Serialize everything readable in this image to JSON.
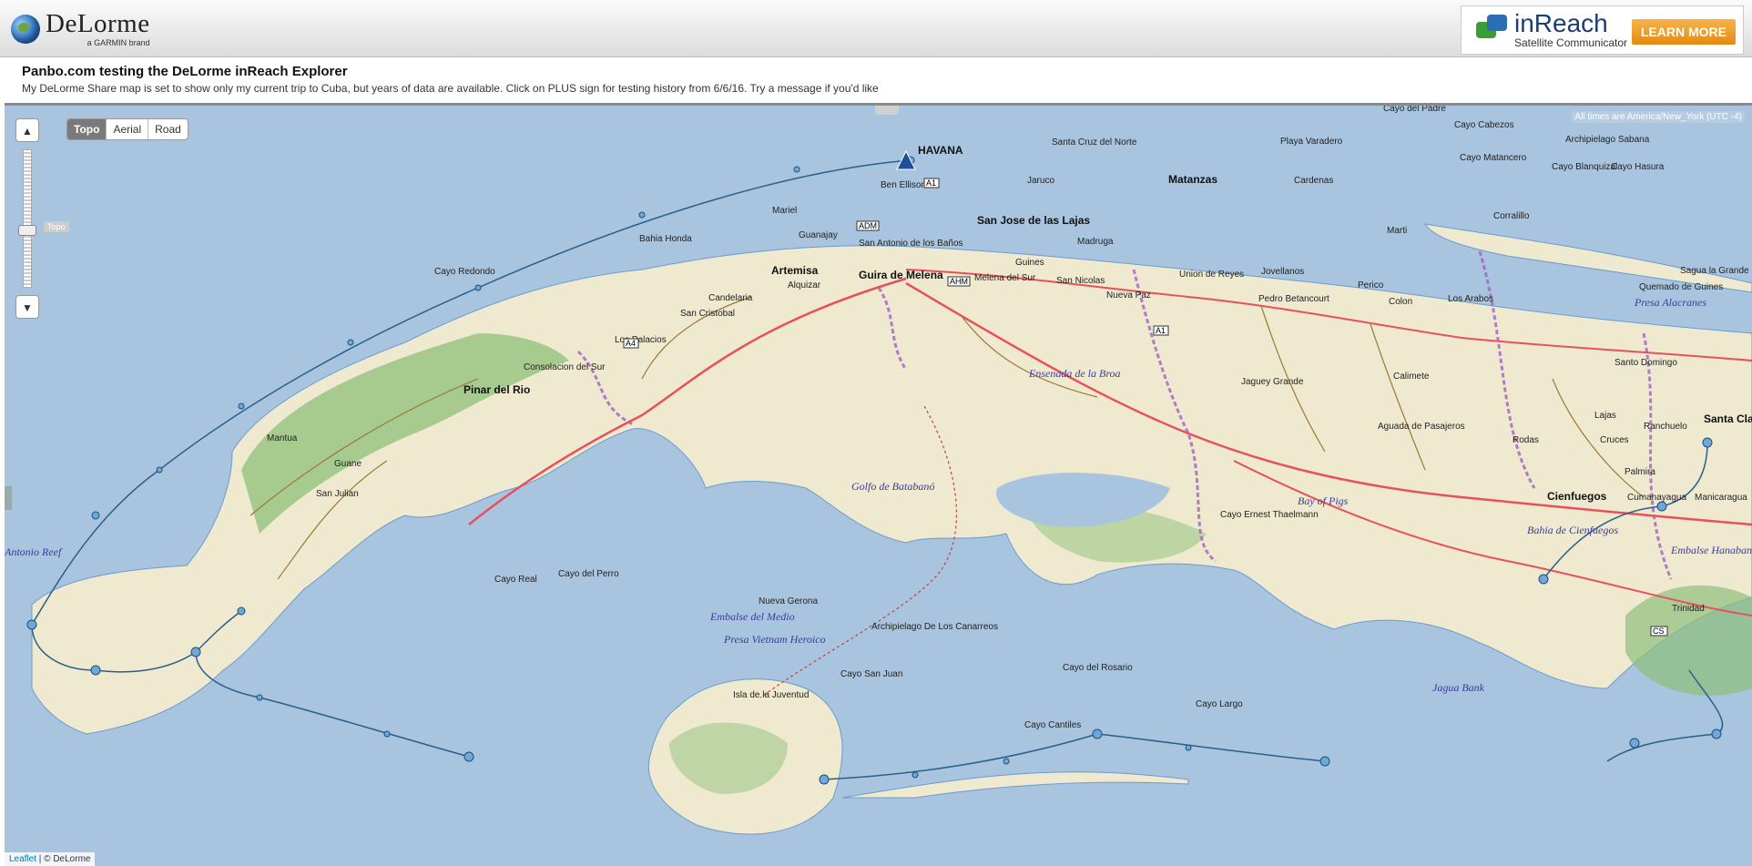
{
  "brand": {
    "name": "DeLorme",
    "sub": "a GARMIN brand"
  },
  "ad": {
    "title": "inReach",
    "subtitle": "Satellite Communicator",
    "button": "LEARN MORE"
  },
  "header": {
    "title": "Panbo.com testing the DeLorme inReach Explorer",
    "description": "My DeLorme Share map is set to show only my current trip to Cuba, but years of data are available. Click on PLUS sign for testing history from 6/6/16. Try a message if you'd like"
  },
  "map": {
    "layers": [
      "Topo",
      "Aerial",
      "Road"
    ],
    "selected_layer": "Topo",
    "zoom_tag": "Topo",
    "timezone": "All times are America/New_York (UTC -4)",
    "credit": {
      "leaflet": "Leaflet",
      "rest": " | © DeLorme"
    },
    "icons": [
      "zoom-in-icon",
      "zoom-out-icon",
      "collapse-icon",
      "expand-icon"
    ]
  },
  "places": {
    "havana": "HAVANA",
    "ben_ellison": "Ben Ellison",
    "mariel": "Mariel",
    "bahia_honda": "Bahia Honda",
    "guanajay": "Guanajay",
    "artemisa": "Artemisa",
    "alquizar": "Alquizar",
    "san_antonio": "San Antonio de los Baños",
    "guira": "Guira de Melena",
    "candelaria": "Candelaria",
    "san_cristobal": "San Cristobal",
    "los_palacios": "Los Palacios",
    "consolacion": "Consolacion del Sur",
    "pinar": "Pinar del Rio",
    "mantua": "Mantua",
    "guane": "Guane",
    "san_julian": "San Julian",
    "cayo_redondo": "Cayo Redondo",
    "santa_cruz": "Santa Cruz del Norte",
    "jaruco": "Jaruco",
    "san_jose": "San Jose de las Lajas",
    "madruga": "Madruga",
    "guines": "Guines",
    "melena": "Melena del Sur",
    "san_nicolas": "San Nicolas",
    "nueva_paz": "Nueva Paz",
    "matanzas": "Matanzas",
    "union": "Union de Reyes",
    "cardenas": "Cardenas",
    "jovellanos": "Jovellanos",
    "marti": "Marti",
    "perico": "Perico",
    "pedro": "Pedro Betancourt",
    "colon": "Colon",
    "los_arabos": "Los Arabos",
    "jaguey": "Jaguey Grande",
    "calimete": "Calimete",
    "aguada": "Aguada de Pasajeros",
    "rodas": "Rodas",
    "lajas": "Lajas",
    "cruces": "Cruces",
    "palmira": "Palmira",
    "cienfuegos": "Cienfuegos",
    "cumanayagua": "Cumanayagua",
    "manicaragua": "Manicaragua",
    "trinidad": "Trinidad",
    "santa_clara": "Santa Clara",
    "santo_domingo": "Santo Domingo",
    "sagua": "Sagua la Grande",
    "quemado": "Quemado de Guines",
    "corralillo": "Corralillo",
    "ranchuelo": "Ranchuelo",
    "nueva_gerona": "Nueva Gerona",
    "isla": "Isla de la Juventud",
    "playa_varadero": "Playa Varadero",
    "cayo_real": "Cayo Real",
    "cayo_perro": "Cayo del Perro",
    "archipielago_canarreos": "Archipielago De Los Canarreos",
    "cayo_san_juan": "Cayo San Juan",
    "cayo_rosario": "Cayo del Rosario",
    "cayo_cantiles": "Cayo Cantiles",
    "cayo_largo": "Cayo Largo",
    "cayo_ernest": "Cayo Ernest Thaelmann",
    "cayo_padre": "Cayo del Padre",
    "cayo_cabezos": "Cayo Cabezos",
    "cayo_matancero": "Cayo Matancero",
    "archipielago_sabana": "Archipielago Sabana",
    "cayo_blanquizal": "Cayo Blanquizal",
    "cayo_hasura": "Cayo Hasura"
  },
  "waters": {
    "golfo": "Golfo de Batabanó",
    "ensenada": "Ensenada de la Broa",
    "bay_pigs": "Bay of Pigs",
    "bahia_cienfuegos": "Bahia de Cienfuegos",
    "jagua": "Jagua Bank",
    "antonio_reef": "Antonio Reef",
    "embalse_medio": "Embalse del Medio",
    "presa_vietnam": "Presa Vietnam Heroico",
    "presa_alacranes": "Presa Alacranes",
    "embalse_hanabanilla": "Embalse Hanabanilla"
  },
  "roads": {
    "a1": "A1",
    "a4": "A4",
    "adm": "ADM",
    "ahm": "AHM",
    "cs": "CS"
  },
  "colors": {
    "water": "#a9c4de",
    "land": "#efe9d0",
    "forest": "#8fbf7a",
    "highway": "#e8505b",
    "road": "#9a7a35",
    "track": "#2a5f8a",
    "boundary": "#a060c0"
  }
}
